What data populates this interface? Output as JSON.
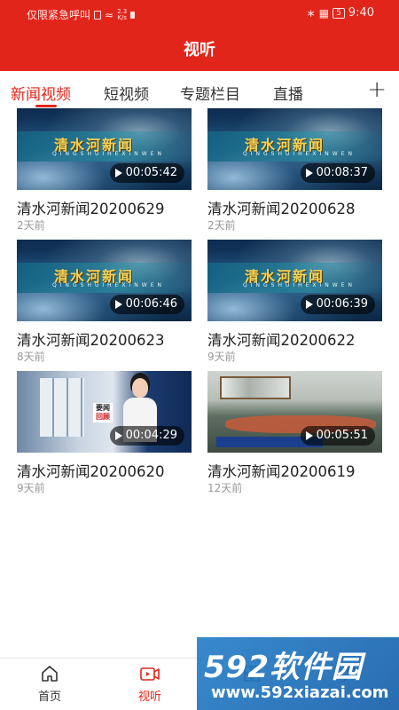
{
  "status_bar": {
    "carrier": "仅限紧急呼叫",
    "speed_value": "2.3",
    "speed_unit": "K/s",
    "battery": "5",
    "time": "9:40"
  },
  "header": {
    "title": "视听"
  },
  "tabs": [
    {
      "label": "新闻视频",
      "active": true
    },
    {
      "label": "短视频",
      "active": false
    },
    {
      "label": "专题栏目",
      "active": false
    },
    {
      "label": "直播",
      "active": false
    }
  ],
  "add_icon": "plus-icon",
  "videos": [
    {
      "title": "清水河新闻20200629",
      "date": "2天前",
      "duration": "00:05:42",
      "thumb": "news",
      "logo_cn": "清水河新闻",
      "logo_en": "QINGSHUIHEXINWEN"
    },
    {
      "title": "清水河新闻20200628",
      "date": "2天前",
      "duration": "00:08:37",
      "thumb": "news",
      "logo_cn": "清水河新闻",
      "logo_en": "QINGSHUIHEXINWEN"
    },
    {
      "title": "清水河新闻20200623",
      "date": "8天前",
      "duration": "00:06:46",
      "thumb": "news",
      "logo_cn": "清水河新闻",
      "logo_en": "QINGSHUIHEXINWEN"
    },
    {
      "title": "清水河新闻20200622",
      "date": "9天前",
      "duration": "00:06:39",
      "thumb": "news",
      "logo_cn": "清水河新闻",
      "logo_en": "QINGSHUIHEXINWEN"
    },
    {
      "title": "清水河新闻20200620",
      "date": "9天前",
      "duration": "00:04:29",
      "thumb": "anchor",
      "tag_top": "要闻",
      "tag_bottom": "回顾"
    },
    {
      "title": "清水河新闻20200619",
      "date": "12天前",
      "duration": "00:05:51",
      "thumb": "meeting"
    }
  ],
  "bottom_nav": [
    {
      "label": "首页",
      "icon": "home-icon",
      "active": false
    },
    {
      "label": "视听",
      "icon": "video-icon",
      "active": true
    },
    {
      "label": "",
      "icon": "grid-icon",
      "active": false
    },
    {
      "label": "",
      "icon": "user-icon",
      "active": false
    }
  ],
  "watermark": {
    "brand": "592软件园",
    "url": "www.592xiazai.com"
  },
  "colors": {
    "brand_red": "#e2251b",
    "text": "#222222",
    "muted": "#999999"
  }
}
